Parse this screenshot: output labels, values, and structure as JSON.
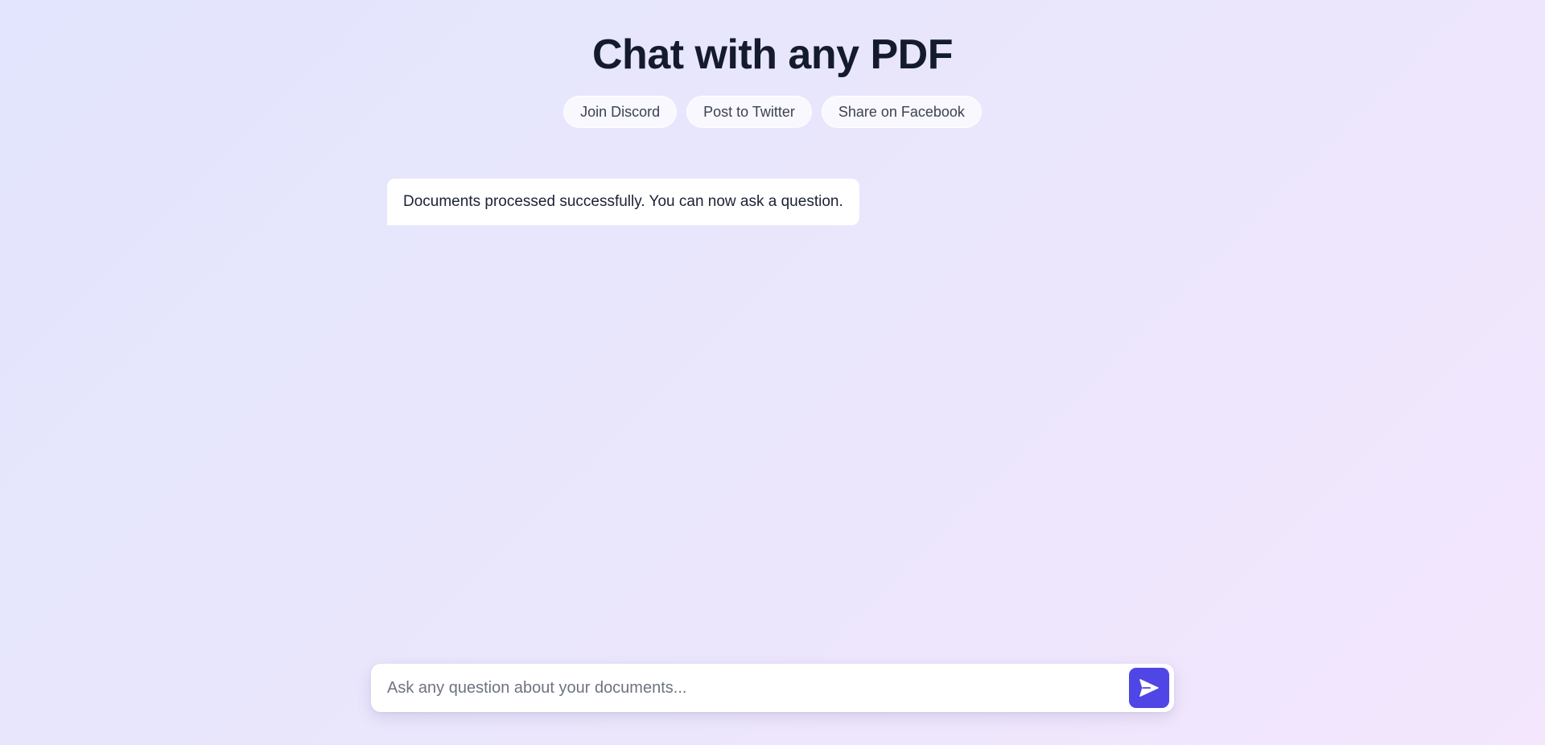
{
  "header": {
    "title": "Chat with any PDF"
  },
  "share_buttons": [
    {
      "label": "Join Discord"
    },
    {
      "label": "Post to Twitter"
    },
    {
      "label": "Share on Facebook"
    }
  ],
  "chat": {
    "messages": [
      {
        "role": "assistant",
        "text": "Documents processed successfully. You can now ask a question."
      }
    ]
  },
  "composer": {
    "placeholder": "Ask any question about your documents...",
    "value": "",
    "send_icon": "send-icon"
  },
  "colors": {
    "accent": "#4f46e5",
    "title": "#141b2d",
    "background_start": "#e2e5fd",
    "background_end": "#f3e6fd"
  }
}
